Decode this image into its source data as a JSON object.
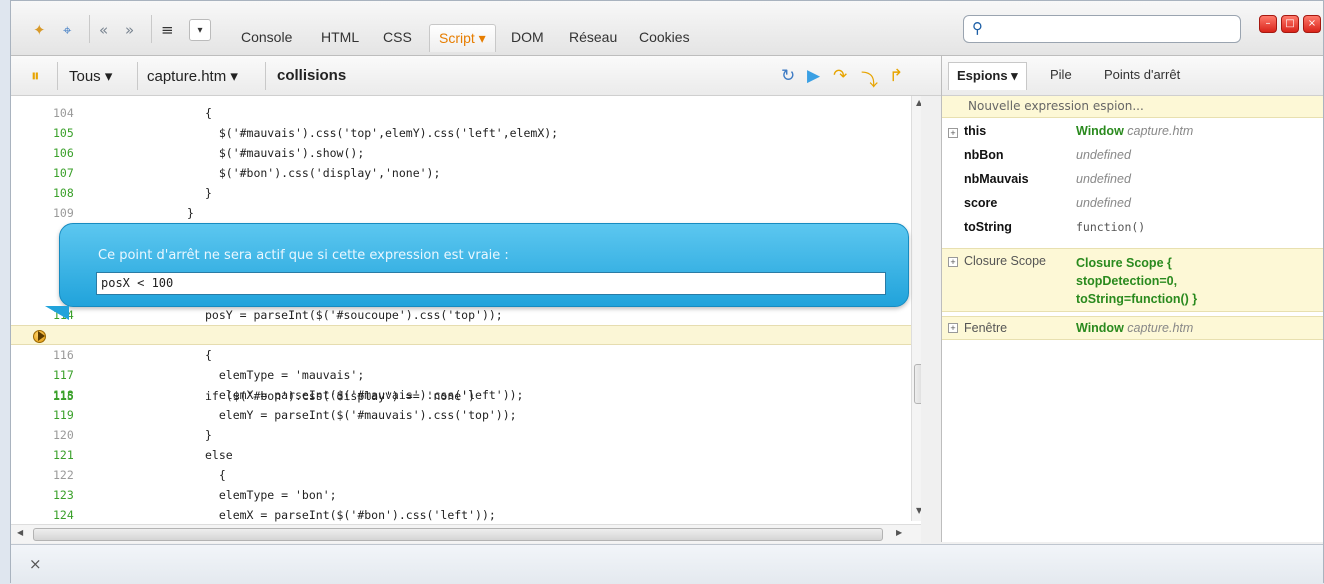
{
  "toolbar": {
    "tabs": [
      "Console",
      "HTML",
      "CSS",
      "Script ▾",
      "DOM",
      "Réseau",
      "Cookies"
    ],
    "search_placeholder": ""
  },
  "script_toolbar": {
    "scope": "Tous ▾",
    "file": "capture.htm ▾",
    "function": "collisions"
  },
  "editor": {
    "lines": [
      {
        "n": "104",
        "code": "{",
        "exec": false
      },
      {
        "n": "105",
        "code": "  $('#mauvais').css('top',elemY).css('left',elemX);",
        "exec": true
      },
      {
        "n": "106",
        "code": "  $('#mauvais').show();",
        "exec": true
      },
      {
        "n": "107",
        "code": "  $('#bon').css('display','none');",
        "exec": true
      },
      {
        "n": "108",
        "code": "}",
        "exec": true
      },
      {
        "n": "109",
        "code": "}",
        "exec": false
      },
      {
        "n": "114",
        "code": "posY = parseInt($('#soucoupe').css('top'));",
        "exec": false
      },
      {
        "n": "115",
        "code": "if ($('#bon').css('display') == 'none')",
        "exec": true
      },
      {
        "n": "116",
        "code": "{",
        "exec": false
      },
      {
        "n": "117",
        "code": "  elemType = 'mauvais';",
        "exec": true
      },
      {
        "n": "118",
        "code": "  elemX = parseInt($('#mauvais').css('left'));",
        "exec": true
      },
      {
        "n": "119",
        "code": "  elemY = parseInt($('#mauvais').css('top'));",
        "exec": true
      },
      {
        "n": "120",
        "code": "}",
        "exec": false
      },
      {
        "n": "121",
        "code": "else",
        "exec": true
      },
      {
        "n": "122",
        "code": "  {",
        "exec": false
      },
      {
        "n": "123",
        "code": "  elemType = 'bon';",
        "exec": true
      },
      {
        "n": "124",
        "code": "  elemX = parseInt($('#bon').css('left'));",
        "exec": true
      }
    ]
  },
  "balloon": {
    "text": "Ce point d'arrêt ne sera actif que si cette expression est vraie :",
    "value": "posX < 100"
  },
  "right_panel": {
    "tabs": [
      "Espions ▾",
      "Pile",
      "Points d'arrêt"
    ],
    "new_watch": "Nouvelle expression espion...",
    "watches": [
      {
        "name": "this",
        "value_bold": "Window",
        "value": "capture.htm",
        "expandable": true
      },
      {
        "name": "nbBon",
        "value": "undefined"
      },
      {
        "name": "nbMauvais",
        "value": "undefined"
      },
      {
        "name": "score",
        "value": "undefined"
      },
      {
        "name": "toString",
        "value": "function()"
      }
    ],
    "closure": {
      "name": "Closure Scope",
      "line1": "Closure Scope {",
      "line2": "stopDetection=0,",
      "line3": "toString=function() }"
    },
    "fenetre": {
      "name": "Fenêtre",
      "value_bold": "Window",
      "value": "capture.htm"
    }
  },
  "status": {
    "close": "×"
  }
}
